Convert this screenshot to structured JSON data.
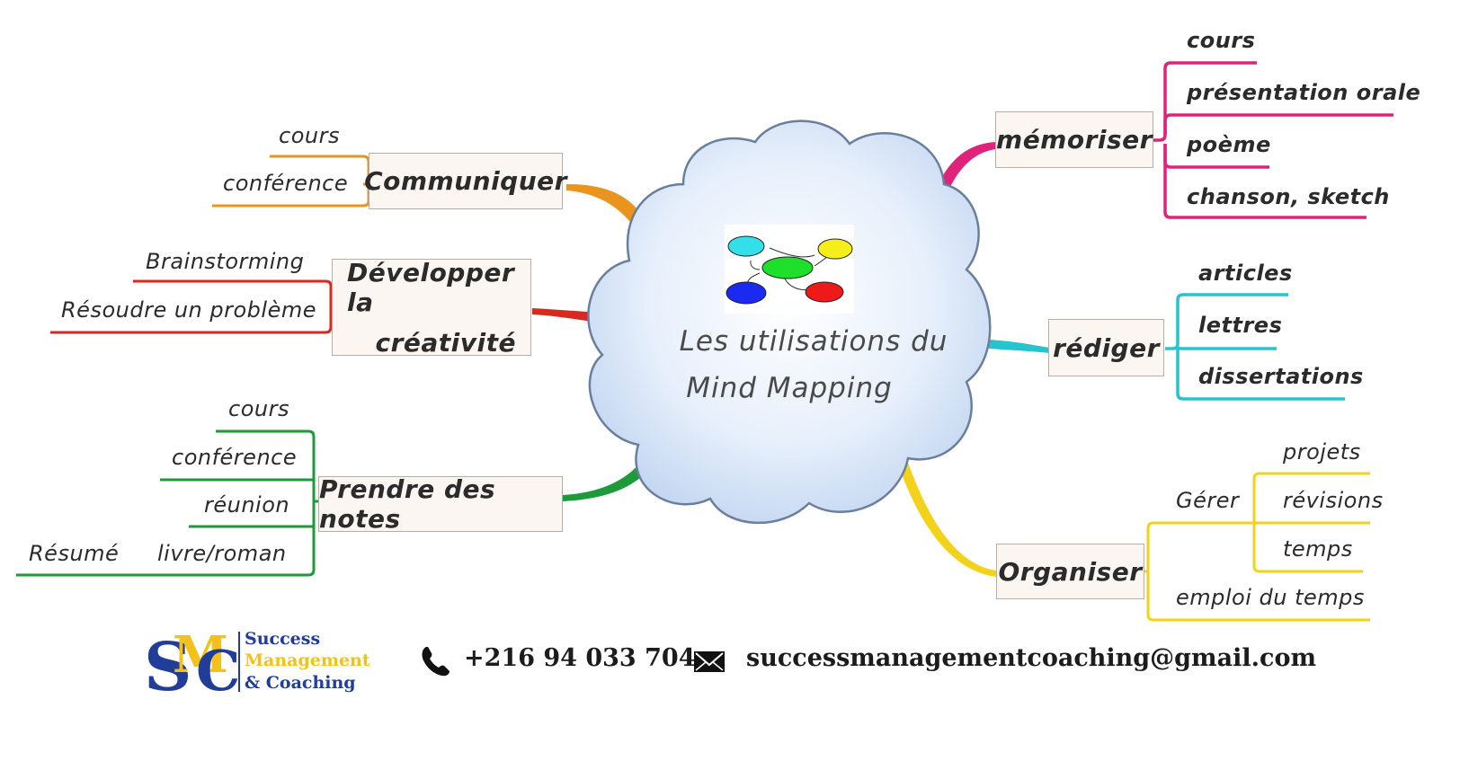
{
  "center": {
    "title_line1": "Les utilisations du",
    "title_line2": "Mind Mapping"
  },
  "branches": {
    "communiquer": {
      "label": "Communiquer",
      "color": "#e8941e",
      "items": [
        "cours",
        "conférence"
      ]
    },
    "developper": {
      "label_line1": "Développer la",
      "label_line2": "créativité",
      "color": "#d42a1f",
      "items": [
        "Brainstorming",
        "Résoudre un problème"
      ]
    },
    "prendre_notes": {
      "label": "Prendre des notes",
      "color": "#1f9a3a",
      "items": [
        "cours",
        "conférence",
        "réunion",
        "livre/roman"
      ],
      "extra": "Résumé"
    },
    "memoriser": {
      "label": "mémoriser",
      "color": "#e0237a",
      "items": [
        "cours",
        "présentation orale",
        "poème",
        "chanson, sketch"
      ]
    },
    "rediger": {
      "label": "rédiger",
      "color": "#26c4cf",
      "items": [
        "articles",
        "lettres",
        "dissertations"
      ]
    },
    "organiser": {
      "label": "Organiser",
      "color": "#f2d21a",
      "gerer_label": "Gérer",
      "gerer_items": [
        "projets",
        "révisions",
        "temps"
      ],
      "other": "emploi du temps"
    }
  },
  "footer": {
    "logo_letters": "SMC",
    "logo_line1": "Success",
    "logo_line2": "Management",
    "logo_line3": "& Coaching",
    "phone": "+216 94 033 704",
    "email": "successmanagementcoaching@gmail.com",
    "phone_icon": "phone-icon",
    "mail_icon": "envelope-icon"
  }
}
